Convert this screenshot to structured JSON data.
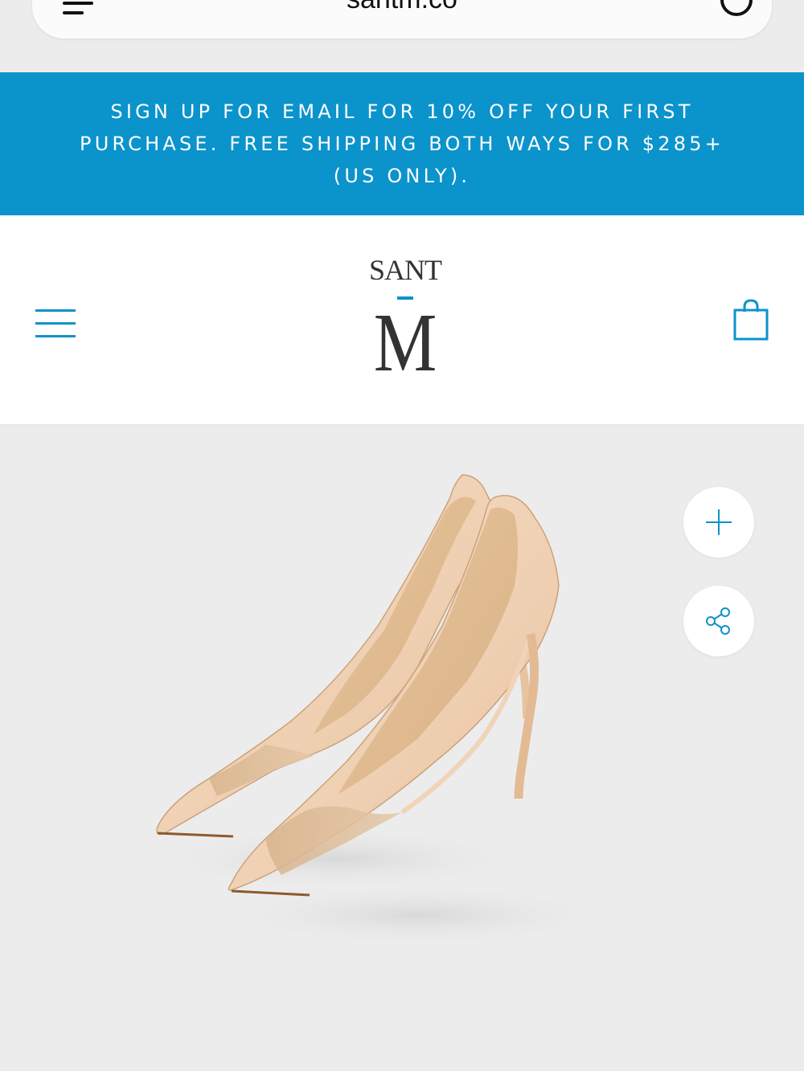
{
  "browser": {
    "url": "santm.co"
  },
  "promo": {
    "line1": "SIGN UP FOR EMAIL FOR 10% OFF YOUR FIRST",
    "line2": "PURCHASE. FREE SHIPPING BOTH WAYS FOR $285+",
    "line3": "(US ONLY)."
  },
  "header": {
    "logo_top": "SANT",
    "logo_bottom": "M"
  },
  "colors": {
    "accent": "#0b93cc",
    "background": "#ececec"
  },
  "icons": {
    "browser_menu": "menu-icon",
    "browser_reload": "circle-icon",
    "site_menu": "hamburger-icon",
    "cart": "shopping-bag-icon",
    "zoom": "plus-icon",
    "share": "share-icon"
  }
}
